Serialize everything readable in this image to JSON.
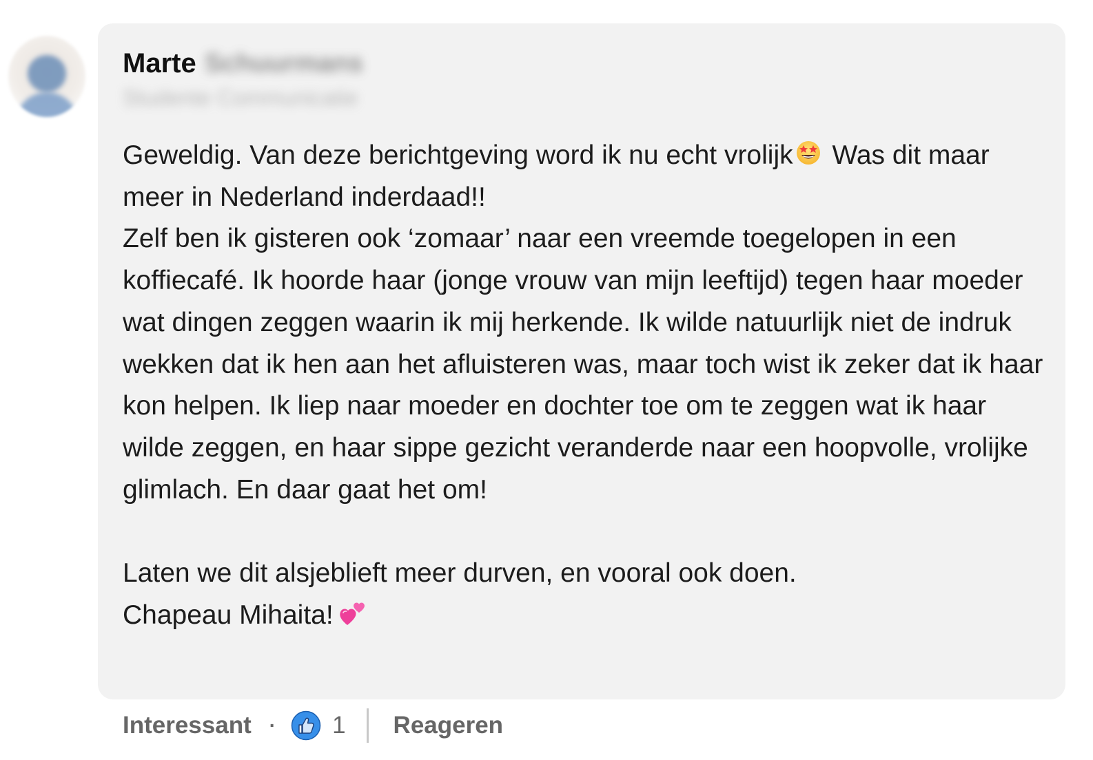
{
  "author": {
    "first_name": "Marte",
    "last_name": "Schuurmans",
    "headline": "Studente Communicatie"
  },
  "comment": {
    "paragraph_1_a": "Geweldig. Van deze berichtgeving word ik nu echt vrolijk",
    "paragraph_1_emoji": "star-struck-emoji",
    "paragraph_1_b": " Was dit maar meer in Nederland inderdaad!!",
    "paragraph_2": "Zelf ben ik gisteren ook ‘zomaar’ naar een vreemde toegelopen in een koffiecafé. Ik hoorde haar (jonge vrouw van mijn leeftijd) tegen haar moeder wat dingen zeggen waarin ik mij herkende. Ik wilde natuurlijk niet de indruk wekken dat ik hen aan het afluisteren was, maar toch wist ik zeker dat ik haar kon helpen. Ik liep naar moeder en dochter toe om te zeggen wat ik haar wilde zeggen, en haar sippe gezicht veranderde naar een hoopvolle, vrolijke glimlach. En daar gaat het om!",
    "paragraph_3": "Laten we dit alsjeblieft meer durven, en vooral ook doen.",
    "paragraph_4": "Chapeau Mihaita!",
    "paragraph_4_emoji": "two-hearts-emoji"
  },
  "actions": {
    "react_label": "Interessant",
    "separator": "·",
    "reaction_icon": "like-thumbs-up-icon",
    "reaction_count": "1",
    "reply_label": "Reageren"
  },
  "colors": {
    "bubble_bg": "#f2f2f2",
    "text": "#1c1c1c",
    "action_text": "#666666",
    "like_blue": "#378fe9"
  }
}
